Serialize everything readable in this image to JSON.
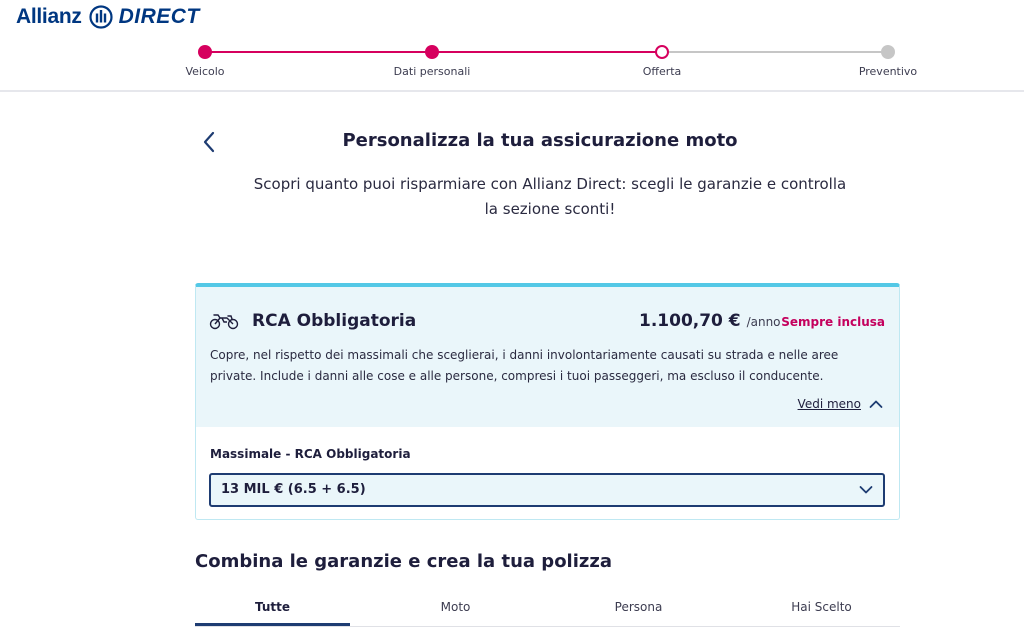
{
  "brand": {
    "word1": "Allianz",
    "word2": "DIRECT",
    "mark_icon": "allianz-eagle-mark"
  },
  "progress": {
    "steps": [
      {
        "label": "Veicolo",
        "state": "completed"
      },
      {
        "label": "Dati personali",
        "state": "completed"
      },
      {
        "label": "Offerta",
        "state": "current"
      },
      {
        "label": "Preventivo",
        "state": "upcoming"
      }
    ],
    "colors": {
      "done": "#d6005e",
      "todo": "#c6c6c6"
    }
  },
  "page": {
    "back_icon": "chevron-left-icon",
    "title": "Personalizza la tua assicurazione moto",
    "subtitle_line1": "Scopri quanto puoi risparmiare con Allianz Direct: scegli le garanzie e controlla",
    "subtitle_line2": "la sezione sconti!"
  },
  "coverage_card": {
    "icon": "motorcycle-icon",
    "title": "RCA Obbligatoria",
    "price": "1.100,70 €",
    "price_period": "/anno",
    "badge": "Sempre inclusa",
    "description_line1": "Copre, nel rispetto dei massimali che sceglierai, i danni involontariamente causati su strada e nelle aree",
    "description_line2": "private. Include i danni alle cose e alle persone, compresi i tuoi passeggeri, ma escluso il conducente.",
    "toggle_label": "Vedi meno",
    "select_label": "Massimale - RCA Obbligatoria",
    "select_value": "13 MIL € (6.5 + 6.5)",
    "accent_color": "#53c8e6"
  },
  "section": {
    "title": "Combina le garanzie e crea la tua polizza",
    "tabs": [
      {
        "label": "Tutte",
        "active": true
      },
      {
        "label": "Moto",
        "active": false
      },
      {
        "label": "Persona",
        "active": false
      },
      {
        "label": "Hai Scelto",
        "active": false
      }
    ]
  }
}
